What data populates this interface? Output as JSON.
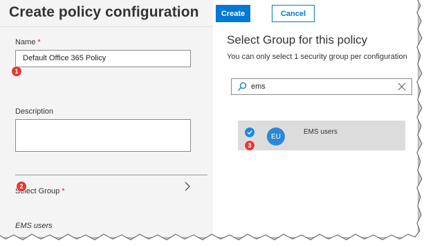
{
  "header": {
    "title": "Create policy configuration",
    "create_label": "Create",
    "cancel_label": "Cancel"
  },
  "form": {
    "name_label": "Name",
    "required_marker": "*",
    "name_value": "Default Office 365 Policy",
    "description_label": "Description",
    "description_value": "",
    "select_group_label": "Select Group",
    "select_group_value": "EMS users"
  },
  "group_panel": {
    "title": "Select Group for this policy",
    "subtitle": "You can only select 1 security group per configuration",
    "search_value": "ems",
    "results": [
      {
        "initials": "EU",
        "name": "EMS users",
        "selected": true
      }
    ]
  },
  "callouts": [
    "1",
    "2",
    "3"
  ],
  "colors": {
    "accent": "#0078d4",
    "left_pane_bg": "#f4f4f4",
    "selected_row_bg": "#dcdcdc",
    "avatar_bg": "#2b88d8",
    "callout_badge": "#e53935",
    "required_marker": "#c4262e"
  },
  "icons": [
    "search-icon",
    "close-icon",
    "chevron-right-icon",
    "check-icon"
  ]
}
